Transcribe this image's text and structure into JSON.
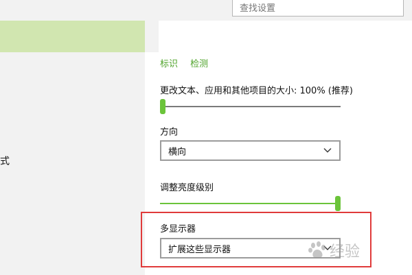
{
  "search": {
    "placeholder": "查找设置"
  },
  "sidebar": {
    "partial_label": "式"
  },
  "links": {
    "identify": "标识",
    "detect": "检测"
  },
  "scale": {
    "label": "更改文本、应用和其他项目的大小: 100% (推荐)",
    "level": 0.0
  },
  "orientation": {
    "label": "方向",
    "selected": "横向"
  },
  "brightness": {
    "label": "调整亮度级别",
    "level": 1.0
  },
  "multi_display": {
    "label": "多显示器",
    "selected": "扩展这些显示器"
  },
  "watermark": {
    "text": "经验"
  },
  "colors": {
    "accent": "#6bc43a",
    "sidebar_highlight": "#d1e6b0",
    "highlight_box": "#e03a3a"
  }
}
